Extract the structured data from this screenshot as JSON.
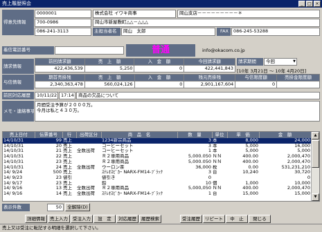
{
  "window": {
    "title": "売上履歴照会"
  },
  "customer": {
    "label": "得意先情報",
    "code": "0000001",
    "company": "株式会社 イワキ商事",
    "branch": "岡山支店－－－－－－－－－＊",
    "postal": "700-0986",
    "address": "岡山市新屋敷町△△－△△△",
    "tel": "086-241-3113",
    "staff_label": "主担当者名",
    "staff": "岡山　太郎",
    "fax_label": "FAX",
    "fax": "086-245-53288"
  },
  "phone_label": "着信電話番号",
  "status_big": "普通",
  "email": "info@okacom.co.jp",
  "billing": {
    "label": "請求情報",
    "headers": [
      "前回請求額",
      "売　上　額",
      "入　金　額",
      "今回請求額"
    ],
    "values": [
      "422,436,539",
      "5,250",
      "0",
      "422,441,843"
    ],
    "period_label": "請求期間",
    "period_select": "今回",
    "period_range": "[10年 3月21日 ～ 10年 4月20日]"
  },
  "credit": {
    "label": "与信情報",
    "headers": [
      "期首売掛残",
      "売　上　額",
      "入　金　額",
      "残元売掛残",
      "与信限度額",
      "売掛金限度額"
    ],
    "values": [
      "2,340,363,478",
      "560,024,126",
      "0",
      "2,901,167,604",
      "0",
      ""
    ]
  },
  "last_contact": {
    "label": "前回対応履歴",
    "date": "10/11/22",
    "time": "17:14",
    "note": "商品の欠品について"
  },
  "memo": {
    "label": "メモ・連絡事項",
    "lines": [
      "月間受注予算が２０００万。",
      "今月は私と４３０万。"
    ]
  },
  "sales_list": {
    "headers": [
      "売上日付",
      "伝票番号",
      "行",
      "出荷区分",
      "商　品　名",
      "数　量",
      "単位",
      "単　価",
      "金　額"
    ],
    "rows": [
      [
        "14/10/31",
        "99",
        "売上",
        "",
        "1234新宗商品",
        "3",
        "本",
        "8,000",
        "24,000"
      ],
      [
        "14/10/31",
        "20",
        "売上",
        "",
        "コーヒーセット",
        "3",
        "本",
        "5,000",
        "16,000"
      ],
      [
        "14/10/31",
        "21",
        "売上",
        "全数出荷",
        "コーヒーセット",
        "1",
        "本",
        "5,000",
        "5,000"
      ],
      [
        "14/10/31",
        "22",
        "売上",
        "",
        "Ｒ２専用商品",
        "5,000.050",
        "ＮＮ",
        "400.00",
        "2,000,470"
      ],
      [
        "14/10/31",
        "23",
        "売上",
        "",
        "Ｒ２専用商品",
        "5,000.050",
        "ＮＮ",
        "400.00",
        "2,000,470"
      ],
      [
        "14/10/31",
        "24",
        "売上",
        "全数出荷",
        "ウーロン茶",
        "36,000",
        "枚",
        "0.00",
        "531,231,210"
      ],
      [
        "14/ 9/24",
        "500",
        "売上",
        "",
        "ｽﾃﾚｵｽﾋﾟｶｰ NARX-FM14-ﾌﾞﾗｯｸ",
        "3",
        "台",
        "10,240",
        "30,720"
      ],
      [
        "14/ 9/23",
        "23",
        "値引",
        "",
        "値引き",
        "0",
        "",
        "",
        "0"
      ],
      [
        "14/ 9/17",
        "23",
        "売上",
        "",
        "鉛",
        "10",
        "個",
        "1,000",
        "10,000"
      ],
      [
        "14/ 9/16",
        "13",
        "売上",
        "全数出荷",
        "Ｒ２専用商品",
        "5,000,050",
        "ＮＮ",
        "400.00",
        "2,000,470"
      ],
      [
        "14/ 9/16",
        "14",
        "売上",
        "全数出荷",
        "ｽﾃﾚｵｽﾋﾟｶｰ NARX-FM14-ﾌﾞﾗｯｸ",
        "1",
        "台",
        "15,000",
        "15,000"
      ]
    ]
  },
  "display_count": {
    "label": "表示件数",
    "value": "50",
    "button": "全解除(D)"
  },
  "buttons": [
    "詳細情報",
    "売上入力",
    "受注入力",
    "設　定",
    "対応履歴",
    "履歴検索",
    "受注履歴",
    "リピート",
    "中　止",
    "閉じる"
  ],
  "status_text": "売上又は受注に転記する明細を選択して下さい。",
  "colors": {
    "titlebar": "#0a246a",
    "label_bg": "#5f6d86",
    "big_status": "#ff00ff",
    "window_bg": "#d4d0c8"
  }
}
